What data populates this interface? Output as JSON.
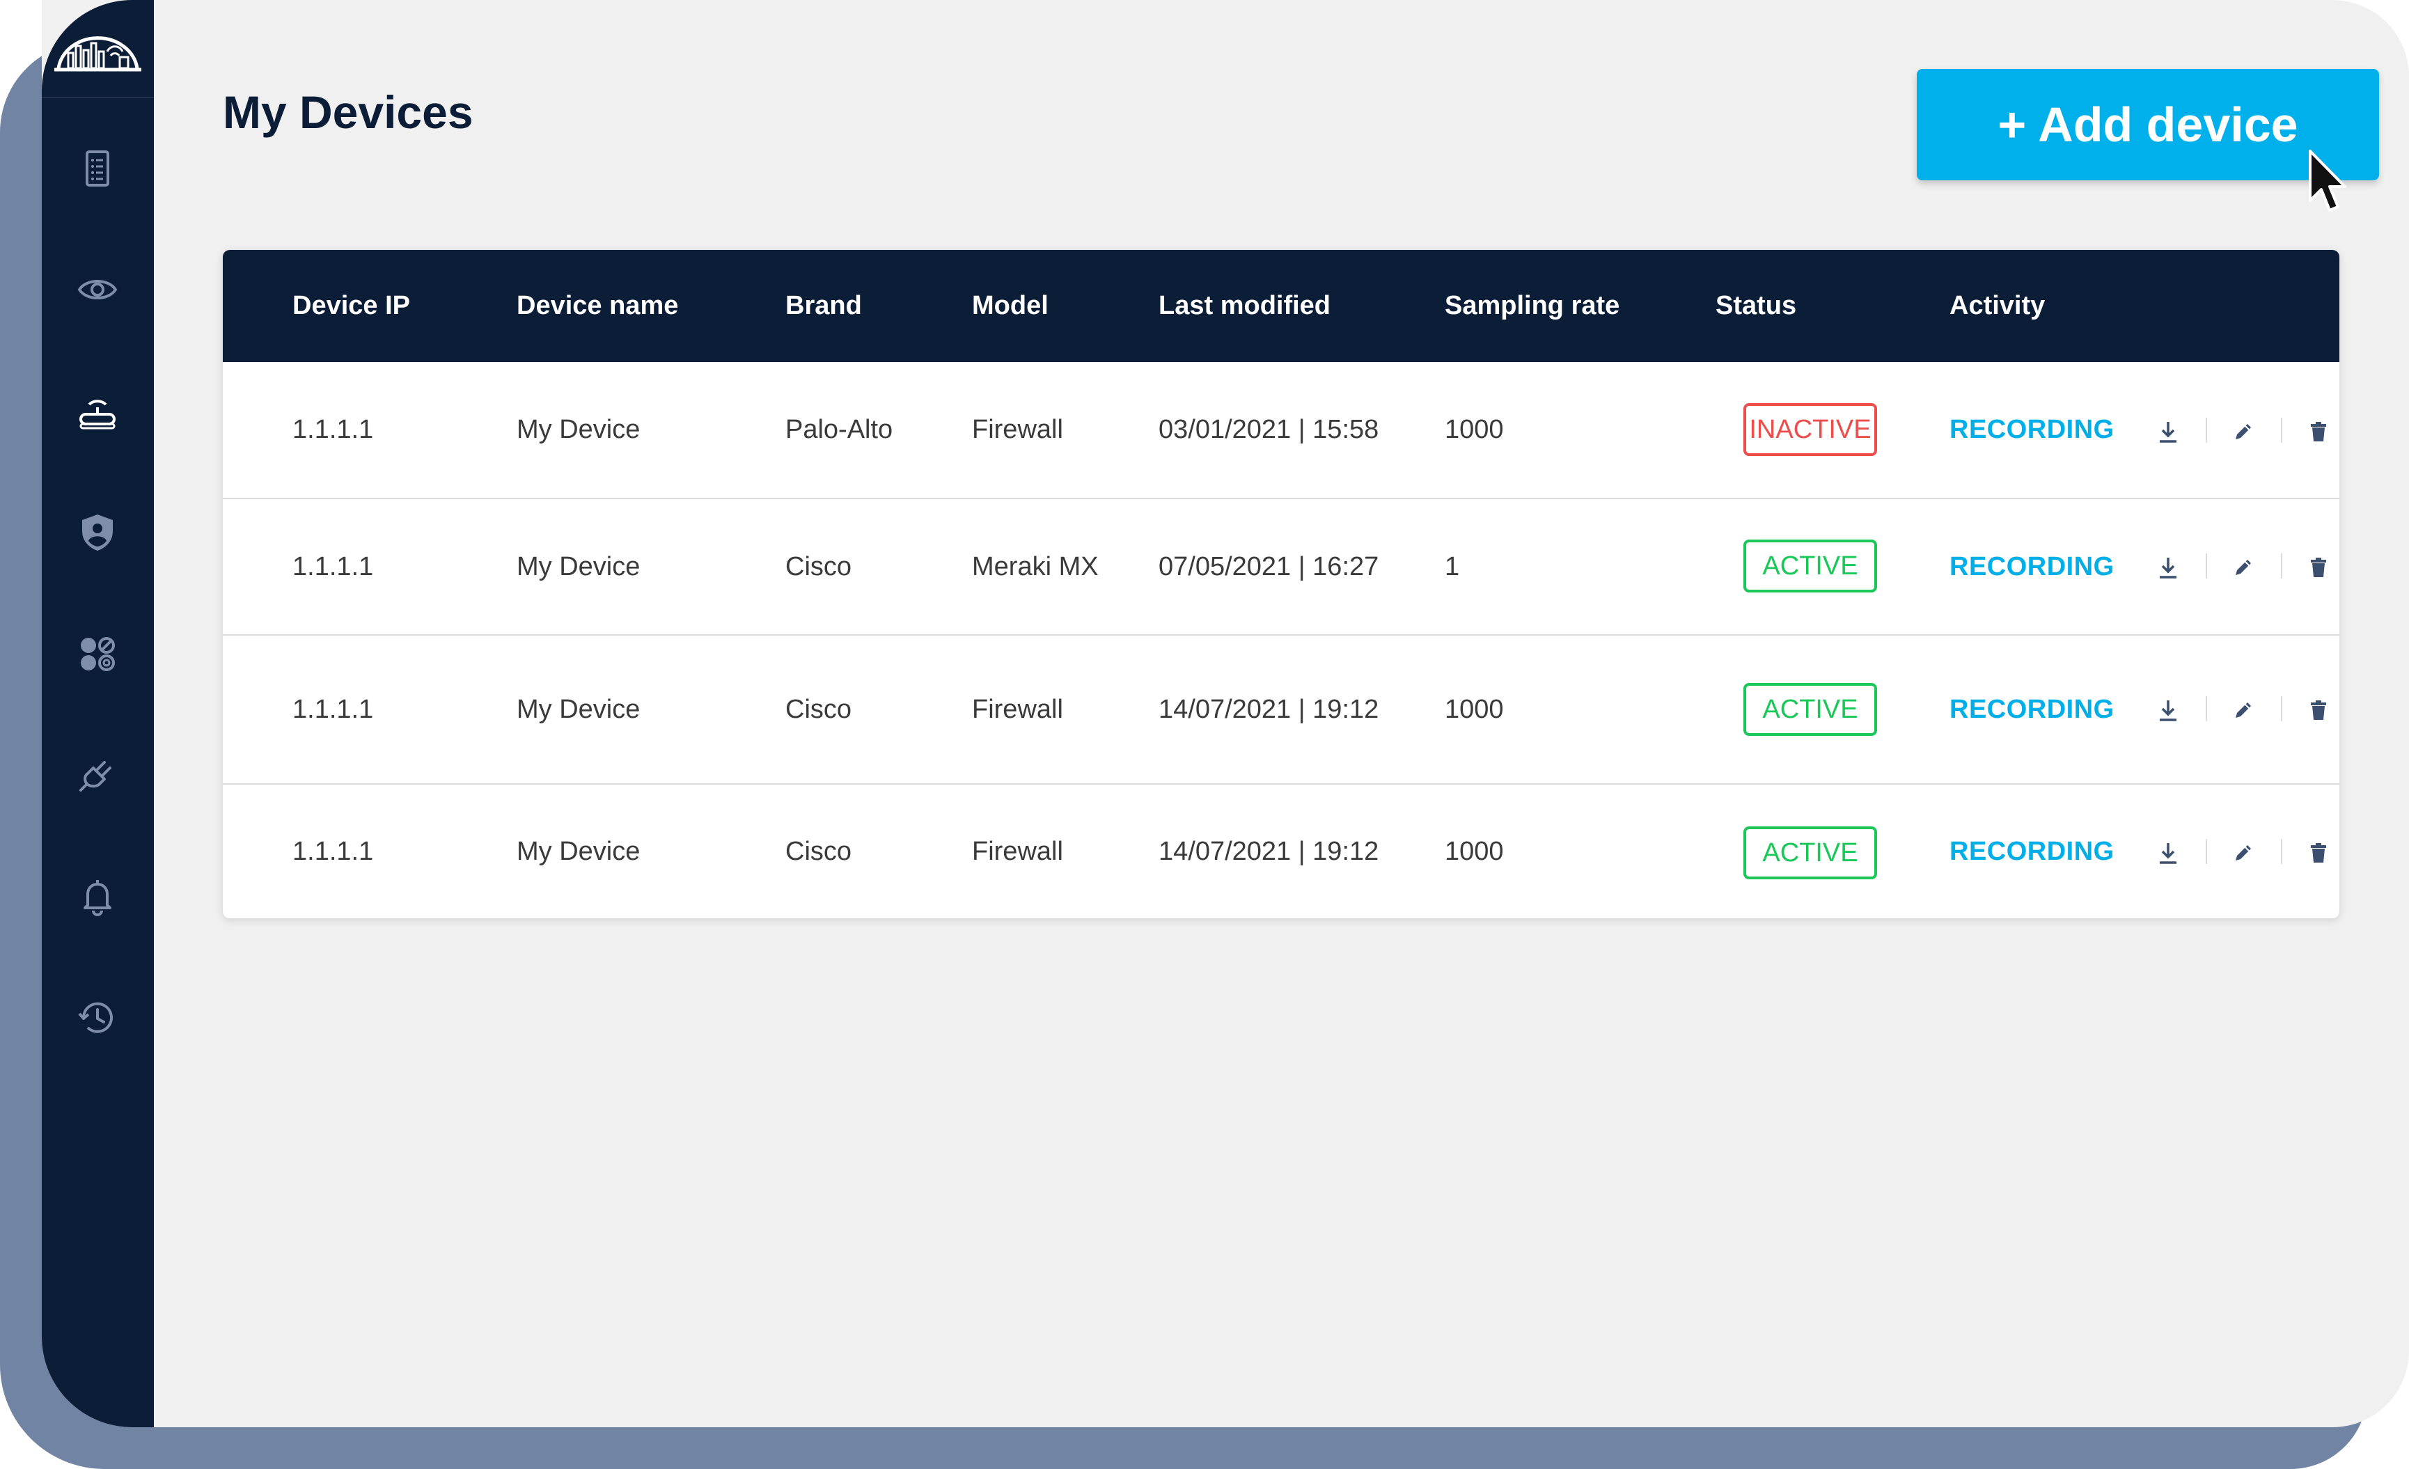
{
  "page": {
    "title": "My Devices",
    "add_button_label": "+ Add device"
  },
  "sidebar": {
    "items": [
      {
        "name": "reports",
        "icon": "document-list-icon"
      },
      {
        "name": "monitor",
        "icon": "eye-icon"
      },
      {
        "name": "devices",
        "icon": "router-icon",
        "active": true
      },
      {
        "name": "security",
        "icon": "shield-user-icon"
      },
      {
        "name": "apps",
        "icon": "apps-grid-icon"
      },
      {
        "name": "integrations",
        "icon": "plug-icon"
      },
      {
        "name": "alerts",
        "icon": "bell-icon"
      },
      {
        "name": "history",
        "icon": "history-icon"
      }
    ]
  },
  "table": {
    "columns": [
      "Device IP",
      "Device name",
      "Brand",
      "Model",
      "Last modified",
      "Sampling rate",
      "Status",
      "Activity"
    ],
    "rows": [
      {
        "ip": "1.1.1.1",
        "name": "My Device",
        "brand": "Palo-Alto",
        "model": "Firewall",
        "modified": "03/01/2021 | 15:58",
        "rate": "1000",
        "status": "INACTIVE",
        "activity": "RECORDING"
      },
      {
        "ip": "1.1.1.1",
        "name": "My Device",
        "brand": "Cisco",
        "model": "Meraki MX",
        "modified": "07/05/2021 | 16:27",
        "rate": "1",
        "status": "ACTIVE",
        "activity": "RECORDING"
      },
      {
        "ip": "1.1.1.1",
        "name": "My Device",
        "brand": "Cisco",
        "model": "Firewall",
        "modified": "14/07/2021 | 19:12",
        "rate": "1000",
        "status": "ACTIVE",
        "activity": "RECORDING"
      },
      {
        "ip": "1.1.1.1",
        "name": "My Device",
        "brand": "Cisco",
        "model": "Firewall",
        "modified": "14/07/2021 | 19:12",
        "rate": "1000",
        "status": "ACTIVE",
        "activity": "RECORDING"
      }
    ],
    "row_actions": [
      "download-icon",
      "edit-pencil-icon",
      "trash-icon"
    ]
  },
  "colors": {
    "sidebar_bg": "#0c1d37",
    "accent": "#00b0ea",
    "status_active": "#19c859",
    "status_inactive": "#ec4e4e",
    "page_bg": "#f0f0f0"
  }
}
